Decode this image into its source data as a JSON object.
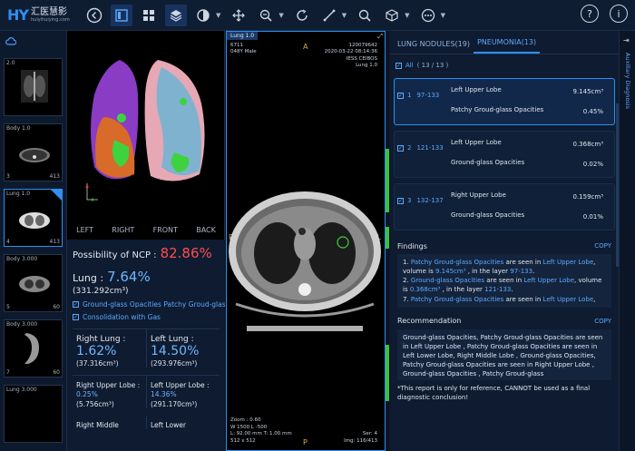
{
  "app": {
    "logo_mark": "HY",
    "logo_cn": "汇医慧影",
    "logo_url": "huiyihuiying.com"
  },
  "toolbar": {
    "icons": [
      "back-icon",
      "layout-single-icon",
      "layout-grid-icon",
      "layers-icon",
      "contrast-icon",
      "pan-icon",
      "zoom-icon",
      "rotate-icon",
      "measure-icon",
      "search-icon",
      "cube-icon",
      "more-icon",
      "help-icon",
      "info-icon"
    ]
  },
  "series": [
    {
      "label": "2.0",
      "num": "",
      "count": ""
    },
    {
      "label": "Body 1.0",
      "num": "3",
      "count": "413"
    },
    {
      "label": "Lung 1.0",
      "num": "4",
      "count": "413"
    },
    {
      "label": "Body 3.000",
      "num": "5",
      "count": "60"
    },
    {
      "label": "Body 3.000",
      "num": "7",
      "count": "60"
    },
    {
      "label": "Lung 3.000",
      "num": "",
      "count": ""
    }
  ],
  "view3d": {
    "labels": [
      "LEFT",
      "RIGHT",
      "FRONT",
      "BACK"
    ]
  },
  "stats": {
    "ncp_label": "Possibility of NCP :",
    "ncp_value": "82.86%",
    "lung_label": "Lung :",
    "lung_value": "7.64%",
    "lung_volume": "(331.292cm³)",
    "check1": "Ground-glass Opacities   Patchy Groud-glass Opacities",
    "check2": "Consolidation with Gas",
    "right_lung_label": "Right Lung :",
    "right_lung_value": "1.62%",
    "right_lung_volume": "(37.316cm³)",
    "left_lung_label": "Left Lung :",
    "left_lung_value": "14.50%",
    "left_lung_volume": "(293.976cm³)",
    "rul_label": "Right Upper Lobe :",
    "rul_value": "0.25%",
    "rul_volume": "(5.756cm³)",
    "lul_label": "Left Upper Lobe :",
    "lul_value": "14.36%",
    "lul_volume": "(291.170cm³)",
    "rml_label": "Right Middle",
    "lll_label": "Left Lower"
  },
  "ct": {
    "tab": "Lung 1.0",
    "tl": [
      "6711",
      "048Y Male"
    ],
    "tr": [
      "120079642",
      "2020-03-22 08:14:36",
      "IESS CEIBOS",
      "Lung 1.0"
    ],
    "bl": [
      "Zoom : 0.60",
      "W 1500 L -500",
      "L: 92.00 mm T: 1.00 mm",
      "512 x 512"
    ],
    "br": [
      "Ser: 4",
      "Img: 116/413"
    ],
    "marker_top": "A",
    "marker_left": "R",
    "marker_right": "L",
    "marker_bottom": "P"
  },
  "right": {
    "tab1": "LUNG NODULES(19)",
    "tab2": "PNEUMONIA(13)",
    "all_label": "All",
    "all_count": "( 13 / 13 )",
    "nodules": [
      {
        "idx": "1",
        "range": "97-133",
        "lobe": "Left Upper Lobe",
        "type": "Patchy Groud-glass Opacities",
        "volume": "9.145cm³",
        "pct": "0.45%"
      },
      {
        "idx": "2",
        "range": "121-133",
        "lobe": "Left Upper Lobe",
        "type": "Ground-glass Opacities",
        "volume": "0.368cm³",
        "pct": "0.02%"
      },
      {
        "idx": "3",
        "range": "132-137",
        "lobe": "Right Upper Lobe",
        "type": "Ground-glass Opacities",
        "volume": "0.159cm³",
        "pct": "0.01%"
      }
    ],
    "findings_title": "Findings",
    "recommendation_title": "Recommendation",
    "copy": "COPY",
    "findings": [
      {
        "n": "1.",
        "type": "Patchy Groud-glass Opacities",
        "mid": " are seen in ",
        "lobe": "Left Upper Lobe",
        "vol_pre": ", volume is ",
        "vol": "9.145cm³",
        "layer_pre": " , in the layer ",
        "layer": "97-133",
        "end": "."
      },
      {
        "n": "2.",
        "type": "Ground-glass Opacities",
        "mid": " are seen in ",
        "lobe": "Left Upper Lobe",
        "vol_pre": ", volume is ",
        "vol": "0.368cm³",
        "layer_pre": " , in the layer ",
        "layer": "121-133",
        "end": "."
      },
      {
        "n": "7.",
        "type": "Patchy Groud-glass Opacities",
        "mid": " are seen in ",
        "lobe": "Left Upper Lobe",
        "vol_pre": ",",
        "vol": "",
        "layer_pre": "",
        "layer": "",
        "end": ""
      }
    ],
    "recommendation": "Ground-glass Opacities, Patchy Groud-glass Opacities are seen in Left Upper Lobe , Patchy Groud-glass Opacities are seen in Left Lower Lobe, Right Middle Lobe , Ground-glass Opacities, Patchy Groud-glass Opacities are seen in Right Upper Lobe , Ground-glass Opacities , Patchy Groud-glass",
    "disclaimer": "*This report is only for reference, CANNOT be used as a final diagnostic conclusion!"
  },
  "aux": {
    "label": "Auxiliary Diagnosis"
  }
}
